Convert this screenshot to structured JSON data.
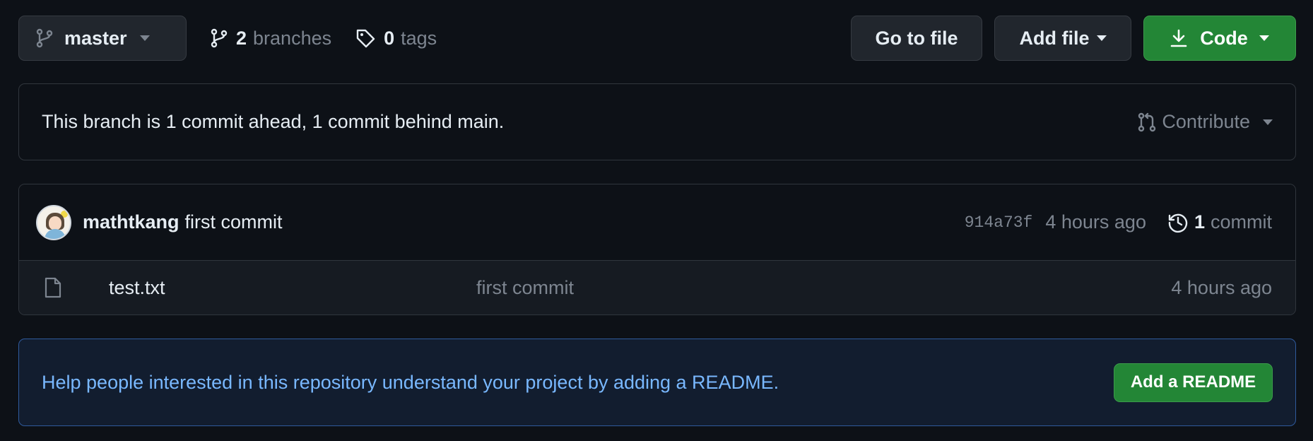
{
  "toolbar": {
    "branch": {
      "name": "master",
      "icon": "git-branch-icon"
    },
    "branches": {
      "count": "2",
      "label": "branches"
    },
    "tags": {
      "count": "0",
      "label": "tags"
    },
    "go_to_file": "Go to file",
    "add_file": "Add file",
    "code": "Code"
  },
  "ahead_behind": {
    "text": "This branch is 1 commit ahead, 1 commit behind main.",
    "contribute": "Contribute"
  },
  "latest_commit": {
    "author": "mathtkang",
    "message": "first commit",
    "sha": "914a73f",
    "time": "4 hours ago",
    "count": "1",
    "count_label": "commit"
  },
  "files": [
    {
      "name": "test.txt",
      "commit_message": "first commit",
      "time": "4 hours ago"
    }
  ],
  "readme_banner": {
    "text": "Help people interested in this repository understand your project by adding a README.",
    "button": "Add a README"
  },
  "colors": {
    "background": "#0d1117",
    "border": "#30363d",
    "text": "#e6edf3",
    "muted": "#7d8590",
    "button_bg": "#21262d",
    "primary_green": "#238636",
    "link_blue": "#79b8ff",
    "banner_border": "#2f5a9c"
  }
}
